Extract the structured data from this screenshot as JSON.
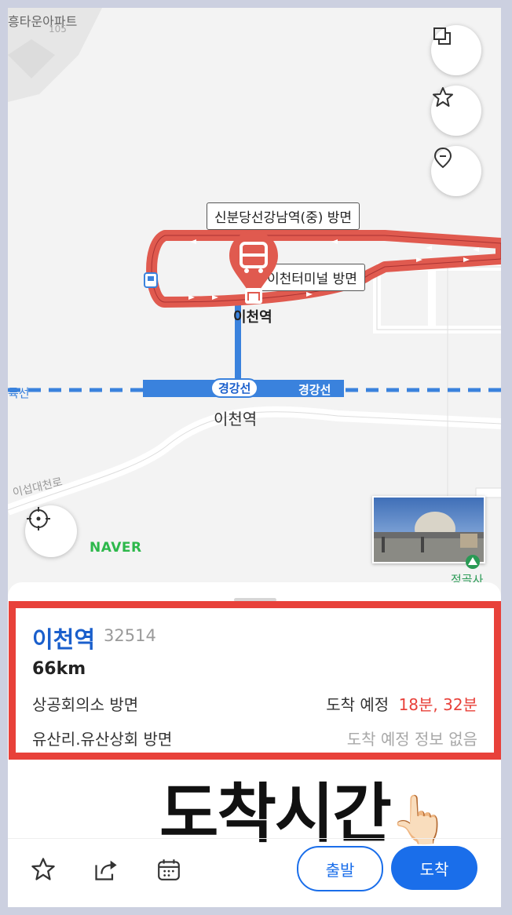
{
  "map": {
    "labels": {
      "apartment": "흥타운아파트",
      "apt_no": "105",
      "route_direction_top": "신분당선강남역(중) 방면",
      "route_direction_mid": "이천터미널 방면",
      "station_pin": "이천역",
      "line_badge": "경강선",
      "line_label": "경강선",
      "line_left": "륙선",
      "station_below": "이천역",
      "road": "이섭대천로",
      "poi": "정골사",
      "brand": "NAVER"
    },
    "buttons": {
      "layers": "layers-icon",
      "favorite": "star-icon",
      "location_pin": "map-pin-icon",
      "current_location": "target-icon"
    }
  },
  "stop": {
    "name": "이천역",
    "id": "32514",
    "distance": "66km",
    "rows": [
      {
        "direction": "상공회의소 방면",
        "arrival_label": "도착 예정",
        "arrival_times": "18분, 32분"
      },
      {
        "direction": "유산리.유산상회 방면",
        "arrival_info": "도착 예정 정보 없음"
      }
    ]
  },
  "overlay": {
    "caption": "도착시간",
    "emoji": "👆🏻"
  },
  "toolbar": {
    "icons": [
      "star-icon",
      "share-icon",
      "calendar-icon"
    ],
    "depart_label": "출발",
    "arrive_label": "도착"
  },
  "colors": {
    "accent": "#1a6eea",
    "highlight": "#e8413a",
    "route": "#e05a4f",
    "rail": "#3a82dd"
  }
}
